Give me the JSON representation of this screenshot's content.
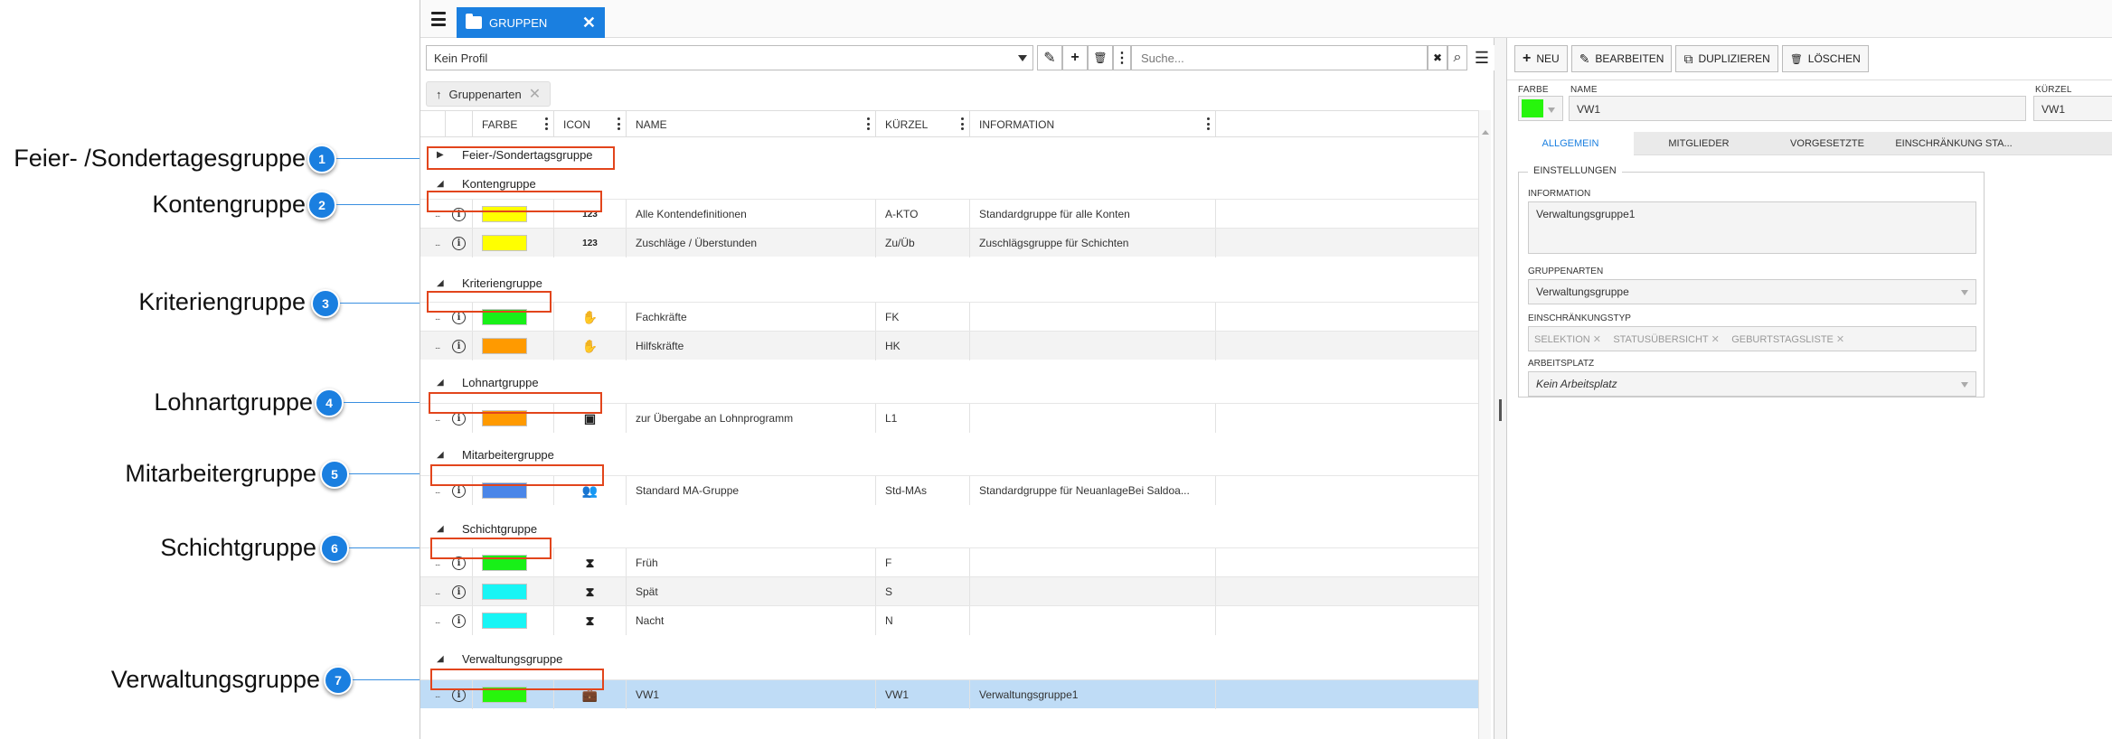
{
  "annotations": [
    {
      "num": "1",
      "label": "Feier- /Sondertagesgruppe"
    },
    {
      "num": "2",
      "label": "Kontengruppe"
    },
    {
      "num": "3",
      "label": "Kriteriengruppe"
    },
    {
      "num": "4",
      "label": "Lohnartgruppe"
    },
    {
      "num": "5",
      "label": "Mitarbeitergruppe"
    },
    {
      "num": "6",
      "label": "Schichtgruppe"
    },
    {
      "num": "7",
      "label": "Verwaltungsgruppe"
    }
  ],
  "topbar": {
    "tab_label": "GRUPPEN",
    "tab_close": "✕"
  },
  "toolbar": {
    "profile_value": "Kein Profil",
    "search_placeholder": "Suche...",
    "edit_icon": "✎",
    "add_icon": "+",
    "delete_icon": "🗑",
    "more_icon": "⋮",
    "clear_icon": "✖",
    "search_icon": "⌕",
    "menu_icon": "☰"
  },
  "chip": {
    "label": "Gruppenarten",
    "arrow": "↑",
    "close": "✕"
  },
  "columns": {
    "farbe": "FARBE",
    "icon": "ICON",
    "name": "NAME",
    "kuerzel": "KÜRZEL",
    "information": "INFORMATION"
  },
  "groups": [
    {
      "title": "Feier-/Sondertagsgruppe",
      "toggle": "▶"
    },
    {
      "title": "Kontengruppe",
      "toggle": "◢"
    },
    {
      "title": "Kriteriengruppe",
      "toggle": "◢"
    },
    {
      "title": "Lohnartgruppe",
      "toggle": "◢"
    },
    {
      "title": "Mitarbeitergruppe",
      "toggle": "◢"
    },
    {
      "title": "Schichtgruppe",
      "toggle": "◢"
    },
    {
      "title": "Verwaltungsgruppe",
      "toggle": "◢"
    }
  ],
  "rows": [
    {
      "color": "#ffff00",
      "icon": "123",
      "icon_name": "numeric-icon",
      "name": "Alle Kontendefinitionen",
      "kuerzel": "A-KTO",
      "info": "Standardgruppe für alle Konten"
    },
    {
      "color": "#ffff00",
      "icon": "123",
      "icon_name": "numeric-icon",
      "name": "Zuschläge / Überstunden",
      "kuerzel": "Zu/Üb",
      "info": "Zuschlägsgruppe für Schichten"
    },
    {
      "color": "#18f018",
      "icon": "✋",
      "icon_name": "hand-icon",
      "name": "Fachkräfte",
      "kuerzel": "FK",
      "info": ""
    },
    {
      "color": "#ff9a00",
      "icon": "✋",
      "icon_name": "hand-icon",
      "name": "Hilfskräfte",
      "kuerzel": "HK",
      "info": ""
    },
    {
      "color": "#ff9a00",
      "icon": "▣",
      "icon_name": "money-icon",
      "name": "zur Übergabe an Lohnprogramm",
      "kuerzel": "L1",
      "info": ""
    },
    {
      "color": "#4a86e8",
      "icon": "👥",
      "icon_name": "users-icon",
      "name": "Standard MA-Gruppe",
      "kuerzel": "Std-MAs",
      "info": "Standardgruppe für NeuanlageBei Saldoa..."
    },
    {
      "color": "#18f018",
      "icon": "⧗",
      "icon_name": "hourglass-icon",
      "name": "Früh",
      "kuerzel": "F",
      "info": ""
    },
    {
      "color": "#18f5f5",
      "icon": "⧗",
      "icon_name": "hourglass-icon",
      "name": "Spät",
      "kuerzel": "S",
      "info": ""
    },
    {
      "color": "#18f5f5",
      "icon": "⧗",
      "icon_name": "hourglass-icon",
      "name": "Nacht",
      "kuerzel": "N",
      "info": ""
    },
    {
      "color": "#27f50c",
      "icon": "💼",
      "icon_name": "briefcase-icon",
      "name": "VW1",
      "kuerzel": "VW1",
      "info": "Verwaltungsgruppe1"
    }
  ],
  "info_glyph": "i",
  "row_dots": "...",
  "detail": {
    "btn_new": "NEU",
    "btn_edit": "BEARBEITEN",
    "btn_duplicate": "DUPLIZIEREN",
    "btn_delete": "LÖSCHEN",
    "icon_new": "+",
    "icon_edit": "✎",
    "icon_duplicate": "⧉",
    "icon_delete": "🗑",
    "lbl_farbe": "FARBE",
    "lbl_name": "NAME",
    "lbl_kuerzel": "KÜRZEL",
    "name_value": "VW1",
    "kuerzel_value": "VW1",
    "color": "#27f50c",
    "tabs": [
      "ALLGEMEIN",
      "MITGLIEDER",
      "VORGESETZTE",
      "EINSCHRÄNKUNG STA..."
    ],
    "fieldset_title": "EINSTELLUNGEN",
    "lbl_information": "INFORMATION",
    "information_value": "Verwaltungsgruppe1",
    "lbl_gruppenarten": "GRUPPENARTEN",
    "gruppenarten_value": "Verwaltungsgruppe",
    "lbl_einschraenkung": "EINSCHRÄNKUNGSTYP",
    "einschraenkung_tags": [
      "SELEKTION",
      "STATUSÜBERSICHT",
      "GEBURTSTAGSLISTE"
    ],
    "tag_close": "✕",
    "lbl_arbeitsplatz": "ARBEITSPLATZ",
    "arbeitsplatz_value": "Kein Arbeitsplatz"
  }
}
